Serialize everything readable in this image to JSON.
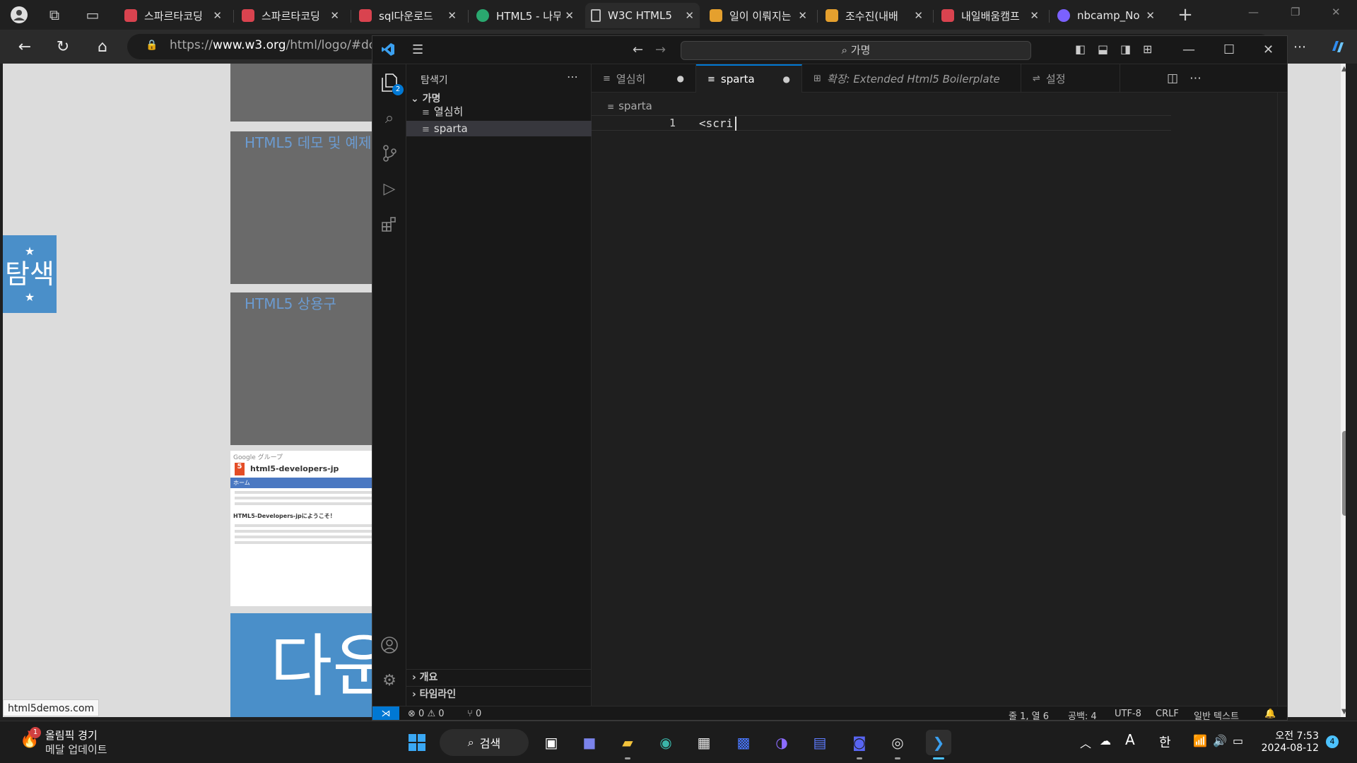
{
  "browser": {
    "tabs": [
      {
        "title": "스파르타코딩",
        "color": "#d9434f"
      },
      {
        "title": "스파르타코딩",
        "color": "#d9434f"
      },
      {
        "title": "sql다운로드",
        "color": "#d9434f"
      },
      {
        "title": "HTML5 - 나무",
        "color": "#2aa86f"
      },
      {
        "title": "W3C HTML5",
        "color": "#bbbbbb"
      },
      {
        "title": "일이 이뤄지는",
        "color": "#e5a02e"
      },
      {
        "title": "조수진(내배",
        "color": "#e5a02e"
      },
      {
        "title": "내일배움캠프",
        "color": "#d9434f"
      },
      {
        "title": "nbcamp_No",
        "color": "#7b61ff"
      }
    ],
    "active_tab_index": 4,
    "url_prefix": "https://",
    "url_host": "www.w3.org",
    "url_path": "/html/logo/#dow",
    "status_link": "html5demos.com"
  },
  "webpage": {
    "search_badge_label": "탐색",
    "img_demo_alt": "HTML5 데모 및 예제",
    "img_tools_alt": "HTML5 상용구",
    "google_brand": "Google グループ",
    "google_group_title": "html5-developers-jp",
    "google_nav": "ホーム",
    "google_welcome": "HTML5-Developers-jpにようこそ！",
    "download_banner": "다운"
  },
  "vscode": {
    "command_center": "가명",
    "explorer_title": "탐색기",
    "folder_name": "가명",
    "files": [
      "열심히",
      "sparta"
    ],
    "selected_file": "sparta",
    "explorer_badge": "2",
    "outline_label": "개요",
    "timeline_label": "타임라인",
    "editor_tabs": [
      {
        "label": "열심히",
        "dirty": true
      },
      {
        "label": "sparta",
        "dirty": true
      },
      {
        "label": "확장: Extended Html5 Boilerplate",
        "dirty": false
      },
      {
        "label": "설정",
        "dirty": false
      }
    ],
    "breadcrumb": "sparta",
    "line_number": "1",
    "code_line": "<scri",
    "status": {
      "errors": "0",
      "warnings": "0",
      "ports": "0",
      "position": "줄 1, 열 6",
      "spaces": "공백: 4",
      "encoding": "UTF-8",
      "eol": "CRLF",
      "language": "일반 텍스트"
    }
  },
  "taskbar": {
    "weather_title": "올림픽 경기",
    "weather_sub": "메달 업데이트",
    "weather_badge": "1",
    "search_label": "검색",
    "ime_label": "한",
    "font_label": "A",
    "time": "오전 7:53",
    "date": "2024-08-12",
    "notifications": "4"
  }
}
